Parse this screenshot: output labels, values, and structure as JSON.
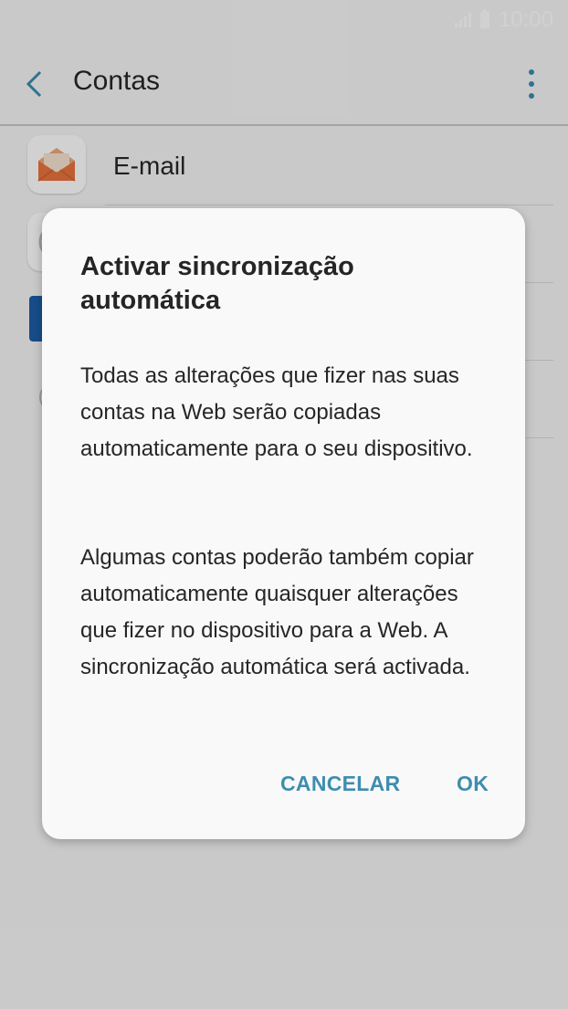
{
  "status_bar": {
    "time": "10:00",
    "signal_icon": "signal-icon",
    "battery_icon": "battery-icon"
  },
  "app_bar": {
    "title": "Contas",
    "back_icon": "chevron-left-icon",
    "more_icon": "more-vertical-icon"
  },
  "accounts": {
    "items": [
      {
        "label": "E-mail",
        "icon": "email-app-icon"
      },
      {
        "label": "",
        "icon": "app-icon"
      },
      {
        "label": "",
        "icon": "app-icon"
      },
      {
        "label": "",
        "icon": "app-icon"
      }
    ]
  },
  "dialog": {
    "title": "Activar sincronização automática",
    "paragraph1": "Todas as alterações que fizer nas suas contas na Web serão copiadas automaticamente para o seu dispositivo.",
    "paragraph2": "Algumas contas poderão também copiar automaticamente quaisquer alterações que fizer no dispositivo para a Web. A sincronização automática será activada.",
    "cancel_label": "CANCELAR",
    "ok_label": "OK"
  },
  "colors": {
    "accent": "#3f8db0",
    "email_icon": "#e8733d",
    "background": "#f6f6f6",
    "dialog_background": "#f9f9f9"
  }
}
